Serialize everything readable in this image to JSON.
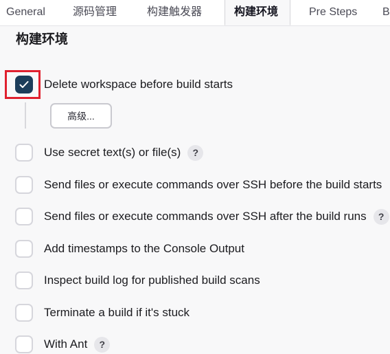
{
  "tabs": [
    {
      "label": "General"
    },
    {
      "label": "源码管理"
    },
    {
      "label": "构建触发器"
    },
    {
      "label": "构建环境"
    },
    {
      "label": "Pre Steps"
    },
    {
      "label": "B"
    }
  ],
  "section": {
    "title": "构建环境"
  },
  "advanced_button": "高级...",
  "help_glyph": "?",
  "options": [
    {
      "label": "Delete workspace before build starts",
      "checked": true
    },
    {
      "label": "Use secret text(s) or file(s)",
      "checked": false
    },
    {
      "label": "Send files or execute commands over SSH before the build starts",
      "checked": false
    },
    {
      "label": "Send files or execute commands over SSH after the build runs",
      "checked": false
    },
    {
      "label": "Add timestamps to the Console Output",
      "checked": false
    },
    {
      "label": "Inspect build log for published build scans",
      "checked": false
    },
    {
      "label": "Terminate a build if it's stuck",
      "checked": false
    },
    {
      "label": "With Ant",
      "checked": false
    }
  ],
  "colors": {
    "checkbox_checked": "#1c3d5a",
    "highlight_border": "#e0202e"
  }
}
